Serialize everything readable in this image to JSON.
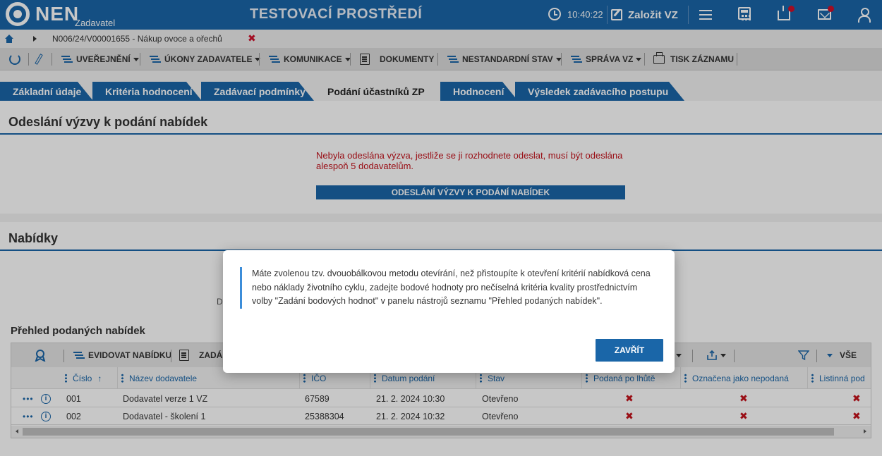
{
  "header": {
    "brand": "NEN",
    "brand_sub": "Zadavatel",
    "env_title": "TESTOVACÍ PROSTŘEDÍ",
    "time": "10:40:22",
    "create_label": "Založit VZ"
  },
  "breadcrumb": {
    "text": "N006/24/V00001655 - Nákup ovoce a ořechů",
    "close": "✖"
  },
  "toolbar": {
    "publish": "UVEŘEJNĚNÍ",
    "acts": "ÚKONY ZADAVATELE",
    "comms": "KOMUNIKACE",
    "docs": "DOKUMENTY",
    "nonstandard": "NESTANDARDNÍ STAV",
    "management": "SPRÁVA VZ",
    "print": "TISK ZÁZNAMU"
  },
  "tabs": [
    {
      "label": "Základní údaje"
    },
    {
      "label": "Kritéria hodnocení"
    },
    {
      "label": "Zadávací podmínky"
    },
    {
      "label": "Podání účastníků ZP"
    },
    {
      "label": "Hodnocení"
    },
    {
      "label": "Výsledek zadávacího postupu"
    }
  ],
  "invite_section": {
    "title": "Odeslání výzvy k podání nabídek",
    "warning": "Nebyla odeslána výzva, jestliže se ji rozhodnete odeslat, musí být odeslána alespoň 5 dodavatelům.",
    "button": "ODESLÁNÍ VÝZVY K PODÁNÍ NABÍDEK"
  },
  "offers_section": {
    "title": "Nabídky",
    "hint_fragment": "D",
    "subheading": "Přehled podaných nabídek"
  },
  "grid": {
    "toolbar": {
      "record_offer": "EVIDOVAT NABÍDKU",
      "enter_partial": "ZADÁ",
      "filter_all": "VŠE"
    },
    "columns": [
      "Číslo",
      "Název dodavatele",
      "IČO",
      "Datum podání",
      "Stav",
      "Podaná po lhůtě",
      "Označena jako nepodaná",
      "Listinná pod"
    ],
    "sort_indicator": "↑",
    "rows": [
      {
        "cislo": "001",
        "nazev": "Dodavatel verze 1 VZ",
        "ico": "67589",
        "datum": "21. 2. 2024 10:30",
        "stav": "Otevřeno",
        "po_lhute": "✖",
        "nepodana": "✖",
        "listinna": "✖"
      },
      {
        "cislo": "002",
        "nazev": "Dodavatel - školení 1",
        "ico": "25388304",
        "datum": "21. 2. 2024 10:32",
        "stav": "Otevřeno",
        "po_lhute": "✖",
        "nepodana": "✖",
        "listinna": "✖"
      }
    ],
    "row_menu": "•••",
    "info_glyph": "i"
  },
  "modal": {
    "message": "Máte zvolenou tzv. dvouobálkovou metodu otevírání, než přistoupíte k otevření kritérií nabídková cena nebo náklady životního cyklu, zadejte bodové hodnoty pro nečíselná kritéria kvality prostřednictvím volby \"Zadání bodových hodnot\" v panelu nástrojů seznamu \"Přehled podaných nabídek\".",
    "close_button": "ZAVŘÍT"
  },
  "icons": {
    "logo": "nen-logo-icon",
    "clock": "clock-icon",
    "menu": "hamburger-menu-icon",
    "calculator": "calculator-icon",
    "inbox": "inbox-icon",
    "mail": "mail-icon",
    "user": "user-icon"
  },
  "colors": {
    "primary": "#1a66a8",
    "alert": "#c4121c",
    "notification": "#d0102b"
  }
}
